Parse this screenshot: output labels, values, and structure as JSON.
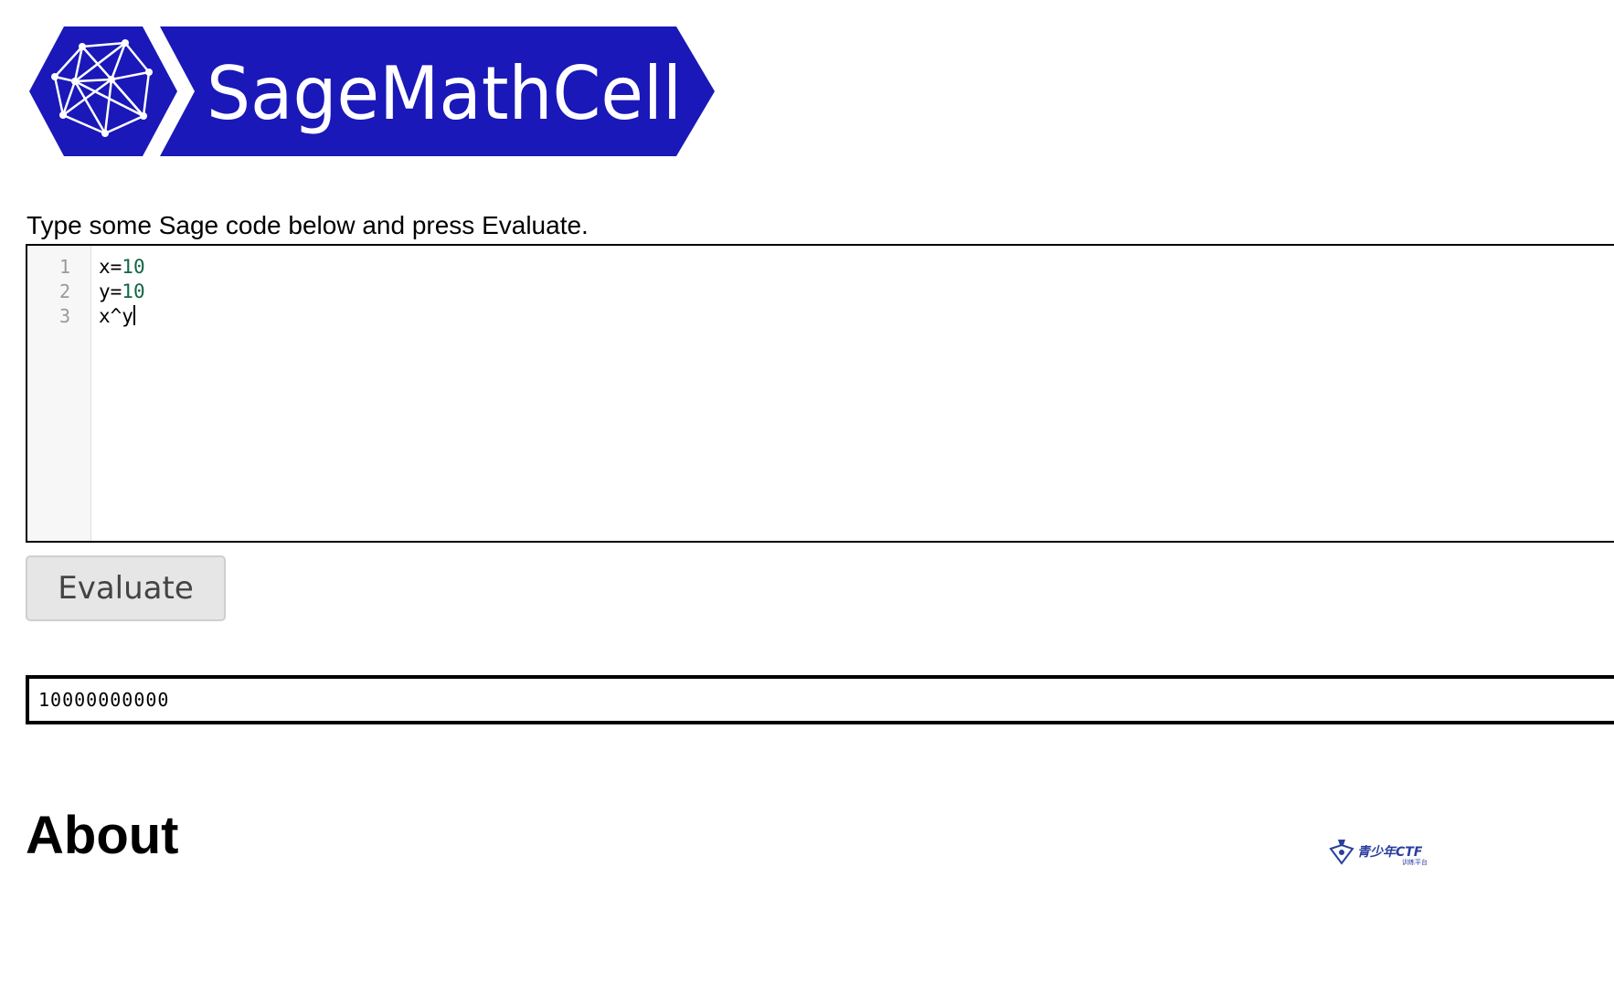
{
  "logo": {
    "text": "SageMathCell",
    "brand_color": "#1a18b8"
  },
  "intro_text": "Type some Sage code below and press Evaluate.",
  "editor": {
    "line_numbers": [
      "1",
      "2",
      "3"
    ],
    "lines": [
      {
        "prefix": "x=",
        "number": "10"
      },
      {
        "prefix": "y=",
        "number": "10"
      },
      {
        "prefix": "x^y",
        "number": ""
      }
    ],
    "number_color": "#116644",
    "gutter_color": "#f7f7f7"
  },
  "evaluate_button": {
    "label": "Evaluate"
  },
  "output": {
    "value": "10000000000"
  },
  "about_heading": "About",
  "watermark": {
    "text": "青少年CTF",
    "subtext": "训练平台"
  }
}
